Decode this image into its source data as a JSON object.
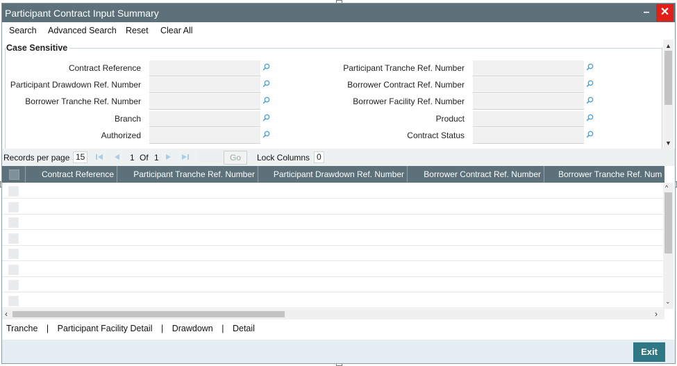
{
  "window": {
    "title": "Participant Contract Input Summary",
    "minimize_glyph": "–",
    "close_glyph": "✕"
  },
  "toolbar": {
    "search": "Search",
    "advanced_search": "Advanced Search",
    "reset": "Reset",
    "clear_all": "Clear All"
  },
  "criteria": {
    "legend": "Case Sensitive",
    "left_fields": [
      {
        "label": "Contract Reference",
        "value": ""
      },
      {
        "label": "Participant Drawdown Ref. Number",
        "value": ""
      },
      {
        "label": "Borrower Tranche Ref. Number",
        "value": ""
      },
      {
        "label": "Branch",
        "value": ""
      },
      {
        "label": "Authorized",
        "value": ""
      }
    ],
    "right_fields": [
      {
        "label": "Participant Tranche Ref. Number",
        "value": ""
      },
      {
        "label": "Borrower Contract Ref. Number",
        "value": ""
      },
      {
        "label": "Borrower Facility Ref. Number",
        "value": ""
      },
      {
        "label": "Product",
        "value": ""
      },
      {
        "label": "Contract Status",
        "value": ""
      }
    ]
  },
  "pager": {
    "records_label": "Records per page",
    "records_value": "15",
    "current_page": "1",
    "of_label": "Of",
    "total_pages": "1",
    "go_label": "Go",
    "lock_label": "Lock Columns",
    "lock_value": "0"
  },
  "grid": {
    "columns": [
      "Contract Reference",
      "Participant Tranche Ref. Number",
      "Participant Drawdown Ref. Number",
      "Borrower Contract Ref. Number",
      "Borrower Tranche Ref. Num"
    ],
    "rows": [
      [],
      [],
      [],
      [],
      [],
      [],
      [],
      []
    ]
  },
  "footer": {
    "links": [
      "Tranche",
      "Participant Facility Detail",
      "Drawdown",
      "Detail"
    ],
    "separator": "|",
    "exit_label": "Exit"
  },
  "colors": {
    "titlebar": "#5c7179",
    "close": "#e0201b",
    "exit": "#2e7785",
    "bottombar": "#e4eef3"
  }
}
